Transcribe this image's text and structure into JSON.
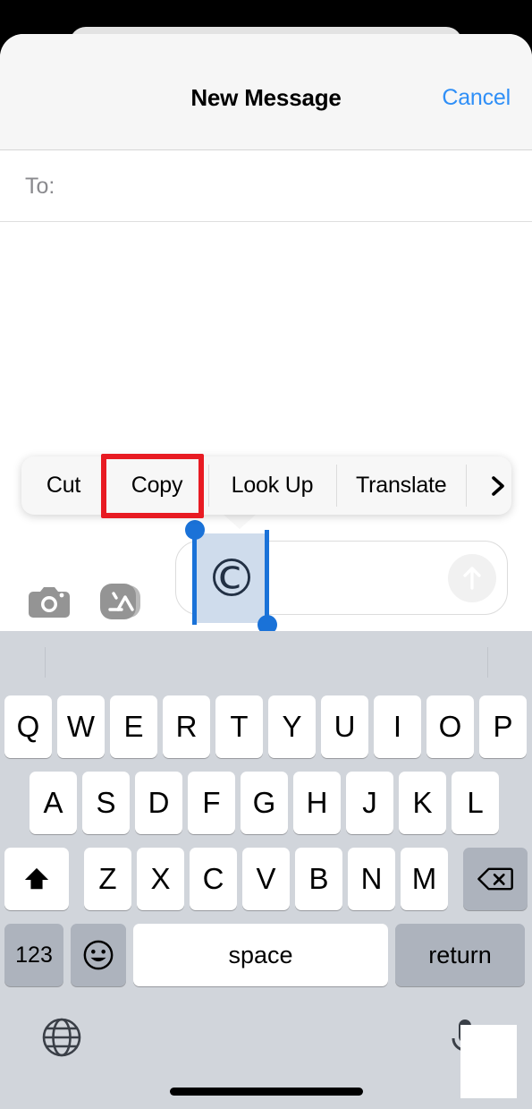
{
  "app": {
    "platform": "iOS",
    "screen_name": "new-message-compose"
  },
  "navbar": {
    "title": "New Message",
    "cancel_label": "Cancel",
    "title_color": "#000000",
    "cancel_color": "#2f8ff7",
    "background": "#f6f6f6"
  },
  "recipient_field": {
    "label": "To:",
    "value": "",
    "placeholder": "",
    "label_color": "#8a8a8e"
  },
  "compose": {
    "camera_icon": "camera-icon",
    "appstore_icon": "app-store-icon",
    "send_icon": "send-arrow-up-icon",
    "input_value": "©",
    "input_placeholder": "",
    "send_enabled": false
  },
  "selection": {
    "selected_text": "©",
    "highlight_color": "#cfdcec",
    "handle_color": "#1a72d8",
    "glyph_color": "#223044"
  },
  "edit_menu": {
    "items": [
      {
        "label": "Cut",
        "name": "cut"
      },
      {
        "label": "Copy",
        "name": "copy"
      },
      {
        "label": "Look Up",
        "name": "look-up"
      },
      {
        "label": "Translate",
        "name": "translate"
      }
    ],
    "more_icon": "chevron-right-icon",
    "background": "#f7f7f7"
  },
  "annotation": {
    "target_label": "Copy",
    "color": "#e81b23",
    "shape": "rectangle"
  },
  "keyboard": {
    "background": "#d1d5db",
    "predictive_bar": {
      "suggestions": [
        "",
        "",
        ""
      ]
    },
    "rows": [
      [
        "Q",
        "W",
        "E",
        "R",
        "T",
        "Y",
        "U",
        "I",
        "O",
        "P"
      ],
      [
        "A",
        "S",
        "D",
        "F",
        "G",
        "H",
        "J",
        "K",
        "L"
      ],
      [
        "Z",
        "X",
        "C",
        "V",
        "B",
        "N",
        "M"
      ]
    ],
    "shift_icon": "shift-arrow-up-icon",
    "backspace_icon": "backspace-delete-icon",
    "numbers_key": "123",
    "emoji_icon": "emoji-smiley-icon",
    "space_key": "space",
    "return_key": "return",
    "globe_icon": "globe-language-icon",
    "mic_icon": "microphone-icon"
  },
  "system": {
    "home_indicator": true
  }
}
